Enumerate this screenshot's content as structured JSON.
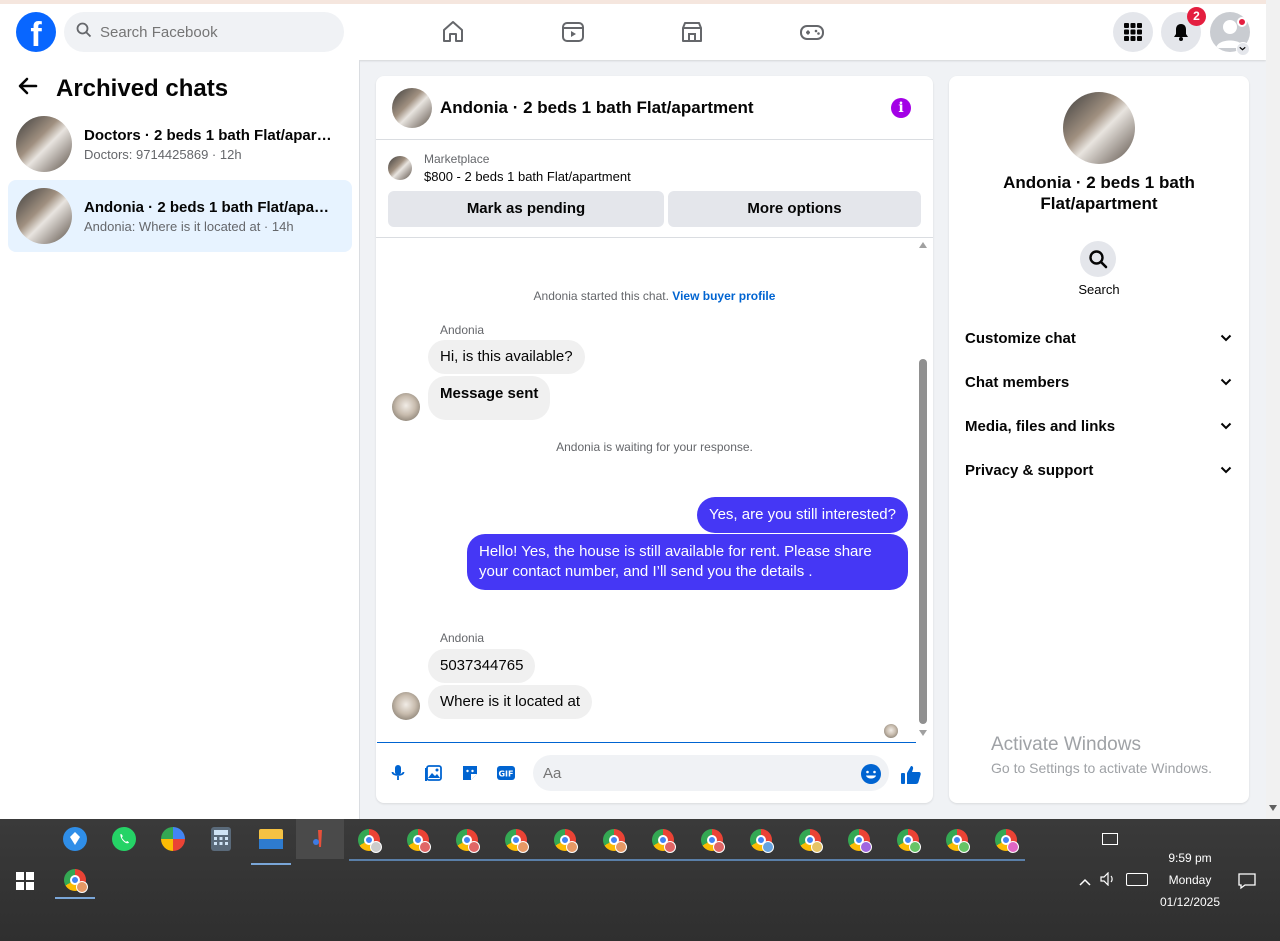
{
  "nav": {
    "search_placeholder": "Search Facebook",
    "notifications_count": "2",
    "brand_color": "#0866ff"
  },
  "sidebar": {
    "title": "Archived chats",
    "chats": [
      {
        "name": "Doctors · 2 beds 1 bath Flat/apart...",
        "subtitle": "Doctors: 9714425869 · 12h",
        "active": false
      },
      {
        "name": "Andonia · 2 beds 1 bath Flat/apart...",
        "subtitle": "Andonia: Where is it located at · 14h",
        "active": true
      }
    ]
  },
  "chat": {
    "title": "Andonia · 2 beds 1 bath Flat/apartment",
    "marketplace_label": "Marketplace",
    "listing": "$800 - 2 beds 1 bath Flat/apartment",
    "buttons": {
      "pending": "Mark as pending",
      "more": "More options"
    },
    "system_started": "Andonia started this chat.",
    "view_buyer": "View buyer profile",
    "system_waiting": "Andonia is waiting for your response.",
    "sender": "Andonia",
    "messages_in_1": [
      "Hi, is this available?",
      "Message sent"
    ],
    "messages_out": [
      "Yes, are you still interested?",
      "Hello! Yes, the house is still available for rent. Please share your contact number, and I’ll send you the details ."
    ],
    "messages_in_2": [
      "5037344765",
      "Where is it located at"
    ],
    "composer_placeholder": "Aa",
    "outgoing_color": "#4537f5"
  },
  "info": {
    "title": "Andonia · 2 beds 1 bath Flat/apartment",
    "search_label": "Search",
    "sections": [
      "Customize chat",
      "Chat members",
      "Media, files and links",
      "Privacy & support"
    ]
  },
  "watermark": {
    "line1": "Activate Windows",
    "line2": "Go to Settings to activate Windows."
  },
  "taskbar": {
    "time": "9:59 pm",
    "day": "Monday",
    "date": "01/12/2025"
  }
}
